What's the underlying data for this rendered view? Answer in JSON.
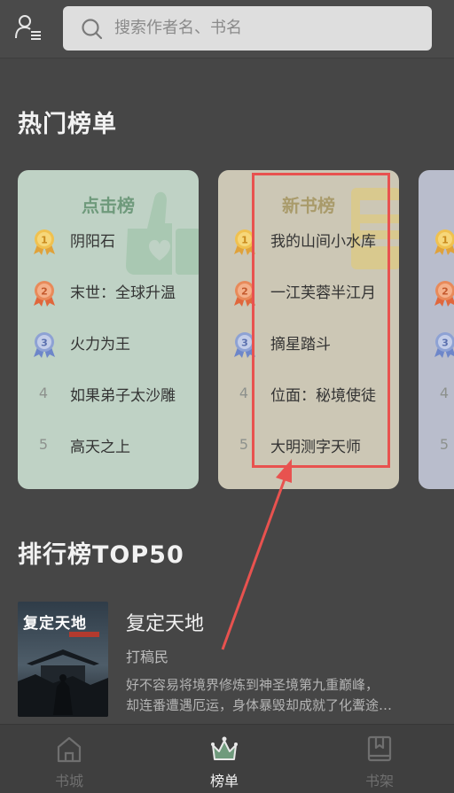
{
  "header": {
    "search_placeholder": "搜索作者名、书名"
  },
  "hot": {
    "title": "热门榜单",
    "cards": [
      {
        "title": "点击榜",
        "items": [
          {
            "rank": "1",
            "name": "阴阳石"
          },
          {
            "rank": "2",
            "name": "末世：全球升温"
          },
          {
            "rank": "3",
            "name": "火力为王"
          },
          {
            "rank": "4",
            "name": "如果弟子太沙雕"
          },
          {
            "rank": "5",
            "name": "高天之上"
          }
        ]
      },
      {
        "title": "新书榜",
        "items": [
          {
            "rank": "1",
            "name": "我的山间小水库"
          },
          {
            "rank": "2",
            "name": "一江芙蓉半江月"
          },
          {
            "rank": "3",
            "name": "摘星踏斗"
          },
          {
            "rank": "4",
            "name": "位面：秘境使徒"
          },
          {
            "rank": "5",
            "name": "大明测字天师"
          }
        ]
      },
      {
        "title": "",
        "items": [
          {
            "rank": "1",
            "name": ""
          },
          {
            "rank": "2",
            "name": ""
          },
          {
            "rank": "3",
            "name": ""
          },
          {
            "rank": "4",
            "name": ""
          },
          {
            "rank": "5",
            "name": ""
          }
        ]
      }
    ]
  },
  "top50": {
    "title": "排行榜TOP50",
    "book": {
      "title": "复定天地",
      "author": "打稿民",
      "desc_line1": "好不容易将境界修炼到神圣境第九重巅峰，",
      "desc_line2": "却连番遭遇厄运，身体暴毁却成就了化聻途…",
      "cover_text": "复定天地"
    }
  },
  "nav": [
    {
      "label": "书城",
      "icon": "home-icon",
      "active": false
    },
    {
      "label": "榜单",
      "icon": "crown-icon",
      "active": true
    },
    {
      "label": "书架",
      "icon": "bookshelf-icon",
      "active": false
    }
  ],
  "colors": {
    "background": "#464646",
    "highlight": "#e8524f",
    "gold": "#e4b84a",
    "silver_red": "#e0805a",
    "bronze_blue": "#8ea2d4"
  }
}
